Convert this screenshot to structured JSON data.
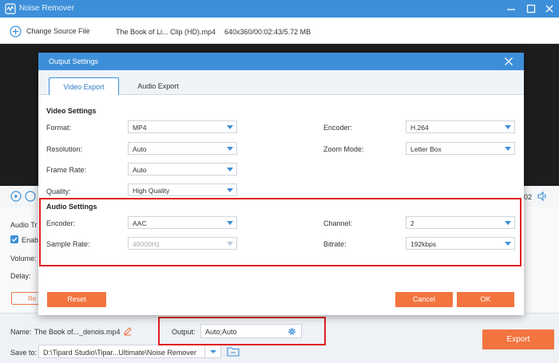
{
  "app": {
    "title": "Noise Remover"
  },
  "toolbar": {
    "change_source": "Change Source File",
    "file_name": "The Book of Li... Clip (HD).mp4",
    "file_meta": "640x360/00:02:43/5.72 MB"
  },
  "player": {
    "time_right": "02"
  },
  "left_panel": {
    "audio_track": "Audio Tr",
    "enable": "Enab",
    "volume": "Volume:",
    "delay": "Delay:",
    "reset_peek": "Re"
  },
  "bottom": {
    "name_label": "Name:",
    "name_value": "The Book of..._denois.mp4",
    "output_label": "Output:",
    "output_value": "Auto;Auto",
    "save_label": "Save to:",
    "save_path": "D:\\Tipard Studio\\Tipar...Ultimate\\Noise Remover",
    "export": "Export"
  },
  "dialog": {
    "title": "Output Settings",
    "tabs": [
      "Video Export",
      "Audio Export"
    ],
    "video": {
      "title": "Video Settings",
      "format_label": "Format:",
      "format": "MP4",
      "resolution_label": "Resolution:",
      "resolution": "Auto",
      "framerate_label": "Frame Rate:",
      "framerate": "Auto",
      "quality_label": "Quality:",
      "quality": "High Quality",
      "encoder_label": "Encoder:",
      "encoder": "H.264",
      "zoom_label": "Zoom Mode:",
      "zoom": "Letter Box"
    },
    "audio": {
      "title": "Audio Settings",
      "encoder_label": "Encoder:",
      "encoder": "AAC",
      "samplerate_label": "Sample Rate:",
      "samplerate": "48000Hz",
      "channel_label": "Channel:",
      "channel": "2",
      "bitrate_label": "Bitrate:",
      "bitrate": "192kbps"
    },
    "reset": "Reset",
    "cancel": "Cancel",
    "ok": "OK"
  },
  "colors": {
    "accent": "#3d8fd9",
    "orange": "#f2743f",
    "highlight": "#dd1f1f"
  }
}
